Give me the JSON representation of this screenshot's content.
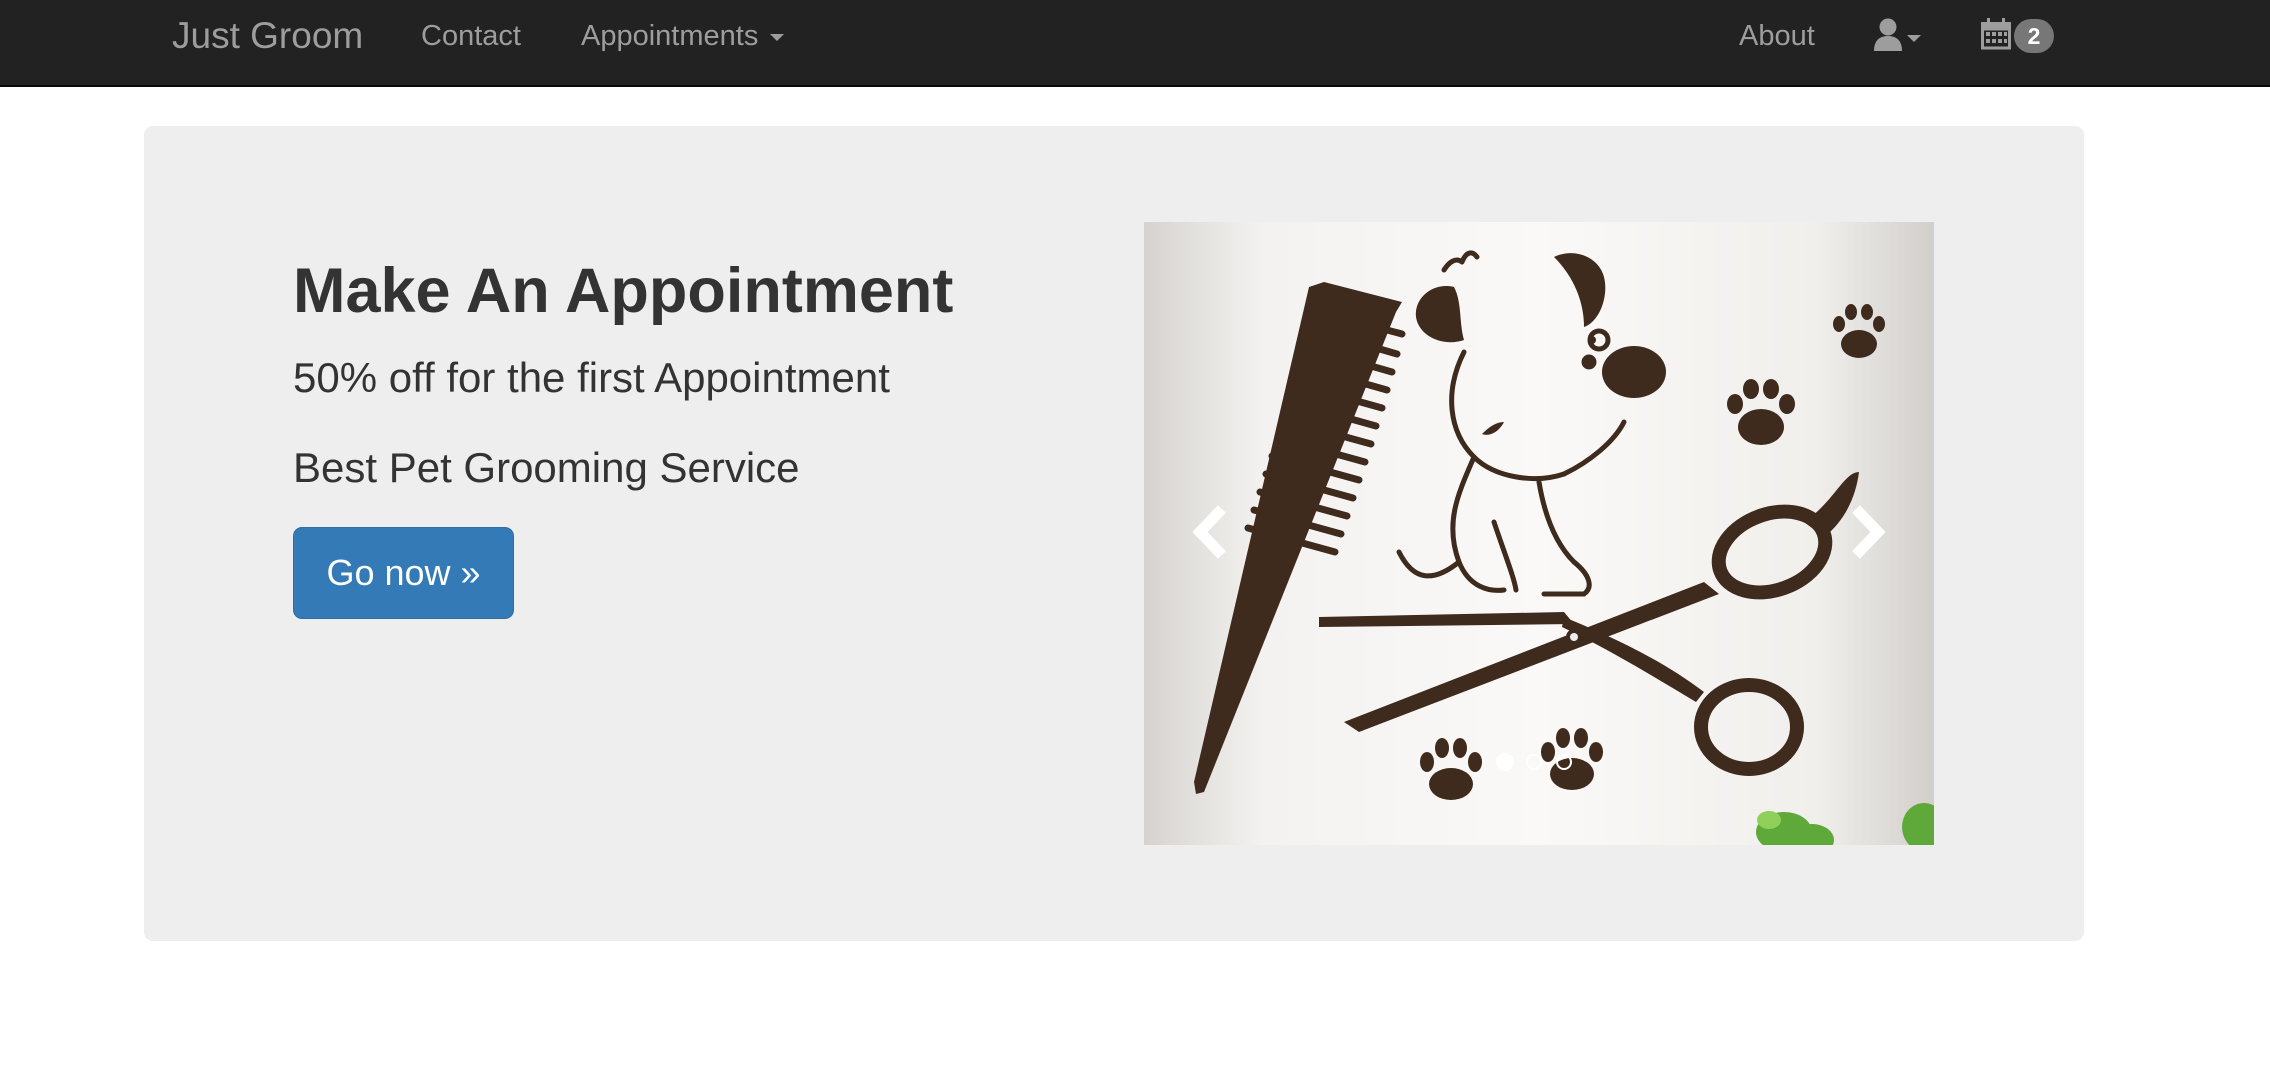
{
  "navbar": {
    "brand": "Just Groom",
    "links": {
      "contact": "Contact",
      "appointments": "Appointments",
      "about": "About"
    },
    "user_icon": "user-icon",
    "calendar_icon": "calendar-icon",
    "calendar_badge": "2",
    "colors": {
      "background": "#222222",
      "text": "#9d9d9d",
      "badge": "#777777"
    }
  },
  "hero": {
    "title": "Make An Appointment",
    "subtitle": "50% off for the first Appointment",
    "tagline": "Best Pet Grooming Service",
    "cta_label": "Go now »",
    "colors": {
      "background": "#eeeeee",
      "cta": "#337ab7"
    }
  },
  "carousel": {
    "slide_count": 3,
    "active_slide": 1,
    "prev_icon": "chevron-left-icon",
    "next_icon": "chevron-right-icon",
    "image_subject": "dog-comb-scissors-paws-illustration"
  }
}
